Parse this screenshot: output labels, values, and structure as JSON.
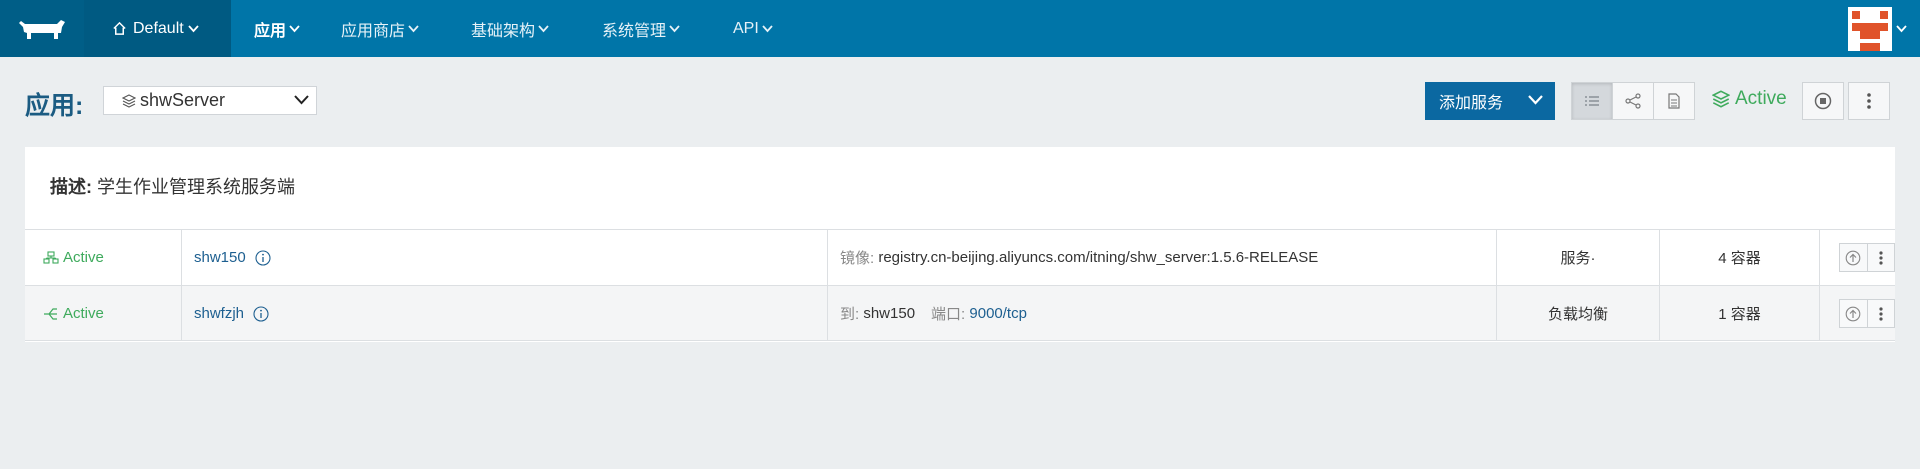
{
  "nav": {
    "environment": "Default",
    "items": [
      {
        "label": "应用",
        "active": true
      },
      {
        "label": "应用商店",
        "active": false
      },
      {
        "label": "基础架构",
        "active": false
      },
      {
        "label": "系统管理",
        "active": false
      },
      {
        "label": "API",
        "active": false
      }
    ]
  },
  "header": {
    "title": "应用:",
    "stack_name": "shwServer",
    "add_service": "添加服务",
    "state": "Active"
  },
  "panel": {
    "desc_key": "描述:",
    "desc_value": " 学生作业管理系统服务端",
    "rows": [
      {
        "state": "Active",
        "name": "shw150",
        "detail_label": "镜像:",
        "detail_value": " registry.cn-beijing.aliyuncs.com/itning/shw_server:1.5.6-RELEASE",
        "type": "服务·",
        "count": "4 容器"
      },
      {
        "state": "Active",
        "name": "shwfzjh",
        "to_label": "到:",
        "to_value": " shw150",
        "port_label": "端口:",
        "port_value": " 9000/tcp",
        "type": "负载均衡",
        "count": "1 容器"
      }
    ]
  },
  "colors": {
    "nav_bg": "#0075a8",
    "active_green": "#3eaa5c",
    "primary_button": "#0b68a1",
    "title_blue": "#1b5b82",
    "avatar_orange": "#e0532a"
  }
}
